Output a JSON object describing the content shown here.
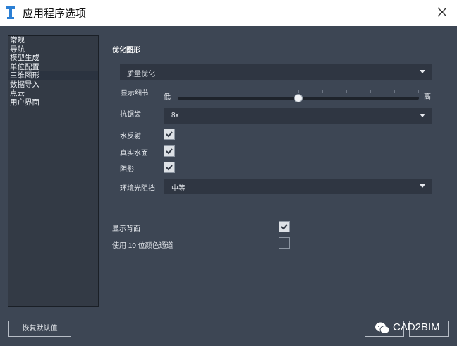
{
  "window": {
    "title": "应用程序选项"
  },
  "nav": {
    "items": [
      "常规",
      "导航",
      "模型生成",
      "单位配置",
      "三维图形",
      "数据导入",
      "点云",
      "用户界面"
    ],
    "selected_index": 4
  },
  "graphics": {
    "section_title": "优化图形",
    "preset": {
      "value": "质量优化"
    },
    "detail": {
      "label": "显示细节",
      "min_label": "低",
      "max_label": "高",
      "level_percent": 50
    },
    "antialias": {
      "label": "抗锯齿",
      "value": "8x"
    },
    "water_reflection": {
      "label": "水反射",
      "checked": true
    },
    "realistic_water": {
      "label": "真实水面",
      "checked": true
    },
    "shadows": {
      "label": "阴影",
      "checked": true
    },
    "ambient_occlusion": {
      "label": "环境光阻挡",
      "value": "中等"
    }
  },
  "extra": {
    "show_backface": {
      "label": "显示背面",
      "checked": true
    },
    "ten_bit_color": {
      "label": "使用 10 位颜色通道",
      "checked": false
    }
  },
  "buttons": {
    "restore_defaults": "恢复默认值"
  },
  "watermark": {
    "text": "CAD2BIM"
  },
  "icons": {
    "app": "app-icon",
    "close": "close-icon",
    "dropdown": "chevron-down-icon",
    "check": "check-icon",
    "wechat": "wechat-icon"
  }
}
